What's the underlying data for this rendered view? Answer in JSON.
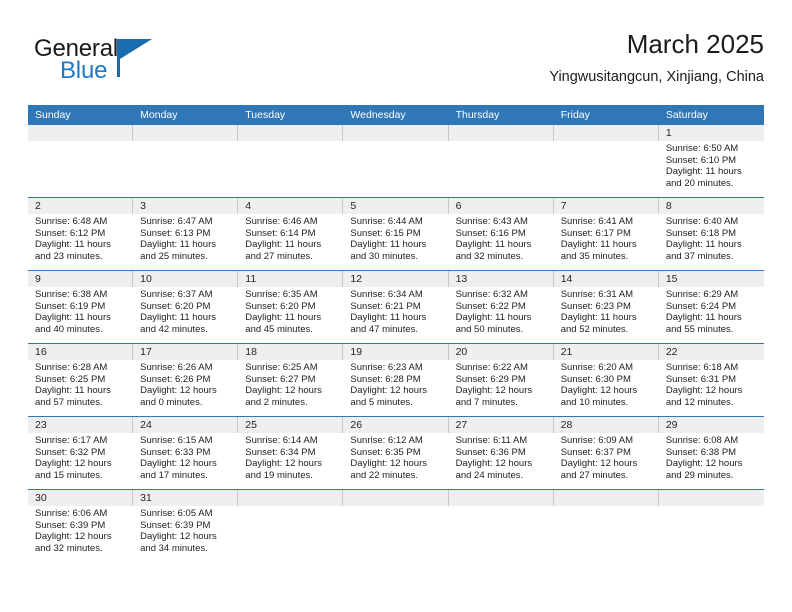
{
  "brand": {
    "name_top": "General",
    "name_bottom": "Blue",
    "accent_color": "#1a6cb0",
    "text_color": "#1a1a1a"
  },
  "header": {
    "title": "March 2025",
    "subtitle": "Yingwusitangcun, Xinjiang, China"
  },
  "theme": {
    "header_blue": "#3077b8",
    "date_band": "#efefef",
    "row_divider": "#3077b8"
  },
  "weekdays": [
    "Sunday",
    "Monday",
    "Tuesday",
    "Wednesday",
    "Thursday",
    "Friday",
    "Saturday"
  ],
  "weeks": [
    [
      {
        "day": ""
      },
      {
        "day": ""
      },
      {
        "day": ""
      },
      {
        "day": ""
      },
      {
        "day": ""
      },
      {
        "day": ""
      },
      {
        "day": "1",
        "sunrise": "Sunrise: 6:50 AM",
        "sunset": "Sunset: 6:10 PM",
        "daylight1": "Daylight: 11 hours",
        "daylight2": "and 20 minutes."
      }
    ],
    [
      {
        "day": "2",
        "sunrise": "Sunrise: 6:48 AM",
        "sunset": "Sunset: 6:12 PM",
        "daylight1": "Daylight: 11 hours",
        "daylight2": "and 23 minutes."
      },
      {
        "day": "3",
        "sunrise": "Sunrise: 6:47 AM",
        "sunset": "Sunset: 6:13 PM",
        "daylight1": "Daylight: 11 hours",
        "daylight2": "and 25 minutes."
      },
      {
        "day": "4",
        "sunrise": "Sunrise: 6:46 AM",
        "sunset": "Sunset: 6:14 PM",
        "daylight1": "Daylight: 11 hours",
        "daylight2": "and 27 minutes."
      },
      {
        "day": "5",
        "sunrise": "Sunrise: 6:44 AM",
        "sunset": "Sunset: 6:15 PM",
        "daylight1": "Daylight: 11 hours",
        "daylight2": "and 30 minutes."
      },
      {
        "day": "6",
        "sunrise": "Sunrise: 6:43 AM",
        "sunset": "Sunset: 6:16 PM",
        "daylight1": "Daylight: 11 hours",
        "daylight2": "and 32 minutes."
      },
      {
        "day": "7",
        "sunrise": "Sunrise: 6:41 AM",
        "sunset": "Sunset: 6:17 PM",
        "daylight1": "Daylight: 11 hours",
        "daylight2": "and 35 minutes."
      },
      {
        "day": "8",
        "sunrise": "Sunrise: 6:40 AM",
        "sunset": "Sunset: 6:18 PM",
        "daylight1": "Daylight: 11 hours",
        "daylight2": "and 37 minutes."
      }
    ],
    [
      {
        "day": "9",
        "sunrise": "Sunrise: 6:38 AM",
        "sunset": "Sunset: 6:19 PM",
        "daylight1": "Daylight: 11 hours",
        "daylight2": "and 40 minutes."
      },
      {
        "day": "10",
        "sunrise": "Sunrise: 6:37 AM",
        "sunset": "Sunset: 6:20 PM",
        "daylight1": "Daylight: 11 hours",
        "daylight2": "and 42 minutes."
      },
      {
        "day": "11",
        "sunrise": "Sunrise: 6:35 AM",
        "sunset": "Sunset: 6:20 PM",
        "daylight1": "Daylight: 11 hours",
        "daylight2": "and 45 minutes."
      },
      {
        "day": "12",
        "sunrise": "Sunrise: 6:34 AM",
        "sunset": "Sunset: 6:21 PM",
        "daylight1": "Daylight: 11 hours",
        "daylight2": "and 47 minutes."
      },
      {
        "day": "13",
        "sunrise": "Sunrise: 6:32 AM",
        "sunset": "Sunset: 6:22 PM",
        "daylight1": "Daylight: 11 hours",
        "daylight2": "and 50 minutes."
      },
      {
        "day": "14",
        "sunrise": "Sunrise: 6:31 AM",
        "sunset": "Sunset: 6:23 PM",
        "daylight1": "Daylight: 11 hours",
        "daylight2": "and 52 minutes."
      },
      {
        "day": "15",
        "sunrise": "Sunrise: 6:29 AM",
        "sunset": "Sunset: 6:24 PM",
        "daylight1": "Daylight: 11 hours",
        "daylight2": "and 55 minutes."
      }
    ],
    [
      {
        "day": "16",
        "sunrise": "Sunrise: 6:28 AM",
        "sunset": "Sunset: 6:25 PM",
        "daylight1": "Daylight: 11 hours",
        "daylight2": "and 57 minutes."
      },
      {
        "day": "17",
        "sunrise": "Sunrise: 6:26 AM",
        "sunset": "Sunset: 6:26 PM",
        "daylight1": "Daylight: 12 hours",
        "daylight2": "and 0 minutes."
      },
      {
        "day": "18",
        "sunrise": "Sunrise: 6:25 AM",
        "sunset": "Sunset: 6:27 PM",
        "daylight1": "Daylight: 12 hours",
        "daylight2": "and 2 minutes."
      },
      {
        "day": "19",
        "sunrise": "Sunrise: 6:23 AM",
        "sunset": "Sunset: 6:28 PM",
        "daylight1": "Daylight: 12 hours",
        "daylight2": "and 5 minutes."
      },
      {
        "day": "20",
        "sunrise": "Sunrise: 6:22 AM",
        "sunset": "Sunset: 6:29 PM",
        "daylight1": "Daylight: 12 hours",
        "daylight2": "and 7 minutes."
      },
      {
        "day": "21",
        "sunrise": "Sunrise: 6:20 AM",
        "sunset": "Sunset: 6:30 PM",
        "daylight1": "Daylight: 12 hours",
        "daylight2": "and 10 minutes."
      },
      {
        "day": "22",
        "sunrise": "Sunrise: 6:18 AM",
        "sunset": "Sunset: 6:31 PM",
        "daylight1": "Daylight: 12 hours",
        "daylight2": "and 12 minutes."
      }
    ],
    [
      {
        "day": "23",
        "sunrise": "Sunrise: 6:17 AM",
        "sunset": "Sunset: 6:32 PM",
        "daylight1": "Daylight: 12 hours",
        "daylight2": "and 15 minutes."
      },
      {
        "day": "24",
        "sunrise": "Sunrise: 6:15 AM",
        "sunset": "Sunset: 6:33 PM",
        "daylight1": "Daylight: 12 hours",
        "daylight2": "and 17 minutes."
      },
      {
        "day": "25",
        "sunrise": "Sunrise: 6:14 AM",
        "sunset": "Sunset: 6:34 PM",
        "daylight1": "Daylight: 12 hours",
        "daylight2": "and 19 minutes."
      },
      {
        "day": "26",
        "sunrise": "Sunrise: 6:12 AM",
        "sunset": "Sunset: 6:35 PM",
        "daylight1": "Daylight: 12 hours",
        "daylight2": "and 22 minutes."
      },
      {
        "day": "27",
        "sunrise": "Sunrise: 6:11 AM",
        "sunset": "Sunset: 6:36 PM",
        "daylight1": "Daylight: 12 hours",
        "daylight2": "and 24 minutes."
      },
      {
        "day": "28",
        "sunrise": "Sunrise: 6:09 AM",
        "sunset": "Sunset: 6:37 PM",
        "daylight1": "Daylight: 12 hours",
        "daylight2": "and 27 minutes."
      },
      {
        "day": "29",
        "sunrise": "Sunrise: 6:08 AM",
        "sunset": "Sunset: 6:38 PM",
        "daylight1": "Daylight: 12 hours",
        "daylight2": "and 29 minutes."
      }
    ],
    [
      {
        "day": "30",
        "sunrise": "Sunrise: 6:06 AM",
        "sunset": "Sunset: 6:39 PM",
        "daylight1": "Daylight: 12 hours",
        "daylight2": "and 32 minutes."
      },
      {
        "day": "31",
        "sunrise": "Sunrise: 6:05 AM",
        "sunset": "Sunset: 6:39 PM",
        "daylight1": "Daylight: 12 hours",
        "daylight2": "and 34 minutes."
      },
      {
        "day": ""
      },
      {
        "day": ""
      },
      {
        "day": ""
      },
      {
        "day": ""
      },
      {
        "day": ""
      }
    ]
  ]
}
